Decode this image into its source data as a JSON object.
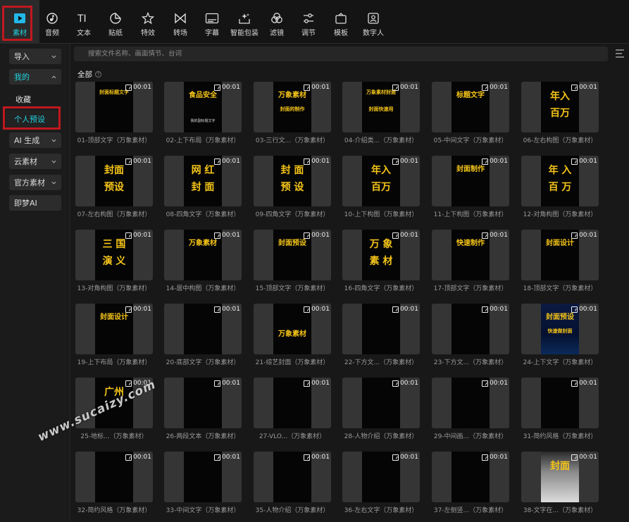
{
  "toolbar": {
    "items": [
      {
        "label": "素材",
        "icon": "media-play-icon"
      },
      {
        "label": "音频",
        "icon": "audio-note-icon"
      },
      {
        "label": "文本",
        "icon": "text-ti-icon"
      },
      {
        "label": "贴纸",
        "icon": "sticker-icon"
      },
      {
        "label": "特效",
        "icon": "effects-star-icon"
      },
      {
        "label": "转场",
        "icon": "transition-bowtie-icon"
      },
      {
        "label": "字幕",
        "icon": "subtitle-icon"
      },
      {
        "label": "智能包装",
        "icon": "smart-pack-icon"
      },
      {
        "label": "滤镜",
        "icon": "filter-icon"
      },
      {
        "label": "调节",
        "icon": "adjust-sliders-icon"
      },
      {
        "label": "模板",
        "icon": "template-icon"
      },
      {
        "label": "数字人",
        "icon": "digital-human-icon"
      }
    ]
  },
  "sidebar": {
    "import": "导入",
    "mine": "我的",
    "favorites": "收藏",
    "personal_preset": "个人预设",
    "ai_generate": "AI 生成",
    "cloud": "云素材",
    "official": "官方素材",
    "jimeng": "即梦AI"
  },
  "search": {
    "placeholder": "搜索文件名称、画面情节、台词"
  },
  "section_title": "全部",
  "section_info": "?",
  "cards": [
    {
      "caption": "01-顶部文字（万象素材）",
      "duration": "00:01",
      "lines": [
        "封面标题文字",
        "",
        ""
      ]
    },
    {
      "caption": "02-上下布局（万象素材）",
      "duration": "00:01",
      "lines": [
        "食品安全",
        "",
        "我的副标题文字"
      ]
    },
    {
      "caption": "03-三行文...（万象素材）",
      "duration": "00:01",
      "lines": [
        "万象素材",
        "封面的制作",
        ""
      ]
    },
    {
      "caption": "04-介绍类...（万象素材）",
      "duration": "00:01",
      "lines": [
        "万象素材封面",
        "封面快速用",
        ""
      ]
    },
    {
      "caption": "05-中间文字（万象素材）",
      "duration": "00:01",
      "lines": [
        "标题文字",
        "",
        ""
      ]
    },
    {
      "caption": "06-左右构图（万象素材）",
      "duration": "00:01",
      "lines": [
        "年入",
        "百万",
        ""
      ]
    },
    {
      "caption": "07-左右构图（万象素材）",
      "duration": "00:01",
      "lines": [
        "封面",
        "预设",
        ""
      ]
    },
    {
      "caption": "08-四角文字（万象素材）",
      "duration": "00:01",
      "lines": [
        "网 红",
        "封 面",
        ""
      ]
    },
    {
      "caption": "09-四角文字（万象素材）",
      "duration": "00:01",
      "lines": [
        "封 面",
        "预 设",
        ""
      ]
    },
    {
      "caption": "10-上下构图（万象素材）",
      "duration": "00:01",
      "lines": [
        "年入",
        "百万",
        ""
      ]
    },
    {
      "caption": "11-上下构图（万象素材）",
      "duration": "00:01",
      "lines": [
        "封面制作",
        "",
        ""
      ]
    },
    {
      "caption": "12-对角构图（万象素材）",
      "duration": "00:01",
      "lines": [
        "年 入",
        "百 万",
        ""
      ]
    },
    {
      "caption": "13-对角构图（万象素材）",
      "duration": "00:01",
      "lines": [
        "三 国",
        "演 义",
        ""
      ]
    },
    {
      "caption": "14-居中构图（万象素材）",
      "duration": "00:01",
      "lines": [
        "万象素材",
        "",
        ""
      ]
    },
    {
      "caption": "15-顶部文字（万象素材）",
      "duration": "00:01",
      "lines": [
        "封面预设",
        "",
        ""
      ]
    },
    {
      "caption": "16-四角文字（万象素材）",
      "duration": "00:01",
      "lines": [
        "万 象",
        "素 材",
        ""
      ]
    },
    {
      "caption": "17-顶部文字（万象素材）",
      "duration": "00:01",
      "lines": [
        "快速制作",
        "",
        ""
      ]
    },
    {
      "caption": "18-顶部文字（万象素材）",
      "duration": "00:01",
      "lines": [
        "封面设计",
        "",
        ""
      ]
    },
    {
      "caption": "19-上下布局（万象素材）",
      "duration": "00:01",
      "lines": [
        "封面设计",
        "",
        ""
      ]
    },
    {
      "caption": "20-底部文字（万象素材）",
      "duration": "00:01",
      "lines": [
        "",
        "",
        ""
      ]
    },
    {
      "caption": "21-综艺封面（万象素材）",
      "duration": "00:01",
      "lines": [
        "",
        "万象素材",
        ""
      ]
    },
    {
      "caption": "22-下方文...（万象素材）",
      "duration": "00:01",
      "lines": [
        "",
        "",
        ""
      ]
    },
    {
      "caption": "23-下方文...（万象素材）",
      "duration": "00:01",
      "lines": [
        "",
        "",
        ""
      ]
    },
    {
      "caption": "24-上下文字（万象素材）",
      "duration": "00:01",
      "lines": [
        "封面预设",
        "快速做封面",
        ""
      ]
    },
    {
      "caption": "25-地标...（万象素材）",
      "duration": "00:01",
      "lines": [
        "广州",
        "",
        ""
      ]
    },
    {
      "caption": "26-两段文本（万象素材）",
      "duration": "00:01",
      "lines": [
        "",
        "",
        ""
      ]
    },
    {
      "caption": "27-VLO...（万象素材）",
      "duration": "00:01",
      "lines": [
        "",
        "",
        ""
      ]
    },
    {
      "caption": "28-人物介绍（万象素材）",
      "duration": "00:01",
      "lines": [
        "",
        "",
        ""
      ]
    },
    {
      "caption": "29-中间画...（万象素材）",
      "duration": "00:01",
      "lines": [
        "",
        "",
        ""
      ]
    },
    {
      "caption": "31-简约风格（万象素材）",
      "duration": "00:01",
      "lines": [
        "",
        "",
        ""
      ]
    },
    {
      "caption": "32-简约风格（万象素材）",
      "duration": "00:01",
      "lines": [
        "",
        "",
        ""
      ]
    },
    {
      "caption": "33-中间文字（万象素材）",
      "duration": "00:01",
      "lines": [
        "",
        "",
        ""
      ]
    },
    {
      "caption": "35-人物介绍（万象素材）",
      "duration": "00:01",
      "lines": [
        "",
        "",
        ""
      ]
    },
    {
      "caption": "36-左右文字（万象素材）",
      "duration": "00:01",
      "lines": [
        "",
        "",
        ""
      ]
    },
    {
      "caption": "37-左侧竖...（万象素材）",
      "duration": "00:01",
      "lines": [
        "",
        "",
        ""
      ]
    },
    {
      "caption": "38-文字在...（万象素材）",
      "duration": "00:01",
      "lines": [
        "封面",
        "",
        ""
      ]
    }
  ],
  "watermark": "www.sucaizy.com",
  "colors": {
    "accent": "#22d3e0",
    "highlight": "#c0181f",
    "title_yellow": "#f5c518"
  }
}
